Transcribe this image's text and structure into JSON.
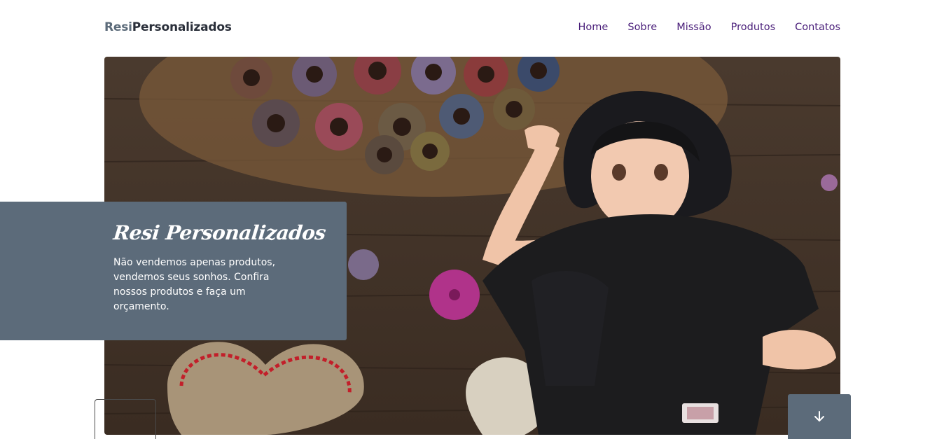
{
  "header": {
    "logo_prefix": "Resi",
    "logo_suffix": "Personalizados",
    "nav": [
      {
        "label": "Home"
      },
      {
        "label": "Sobre"
      },
      {
        "label": "Missão"
      },
      {
        "label": "Produtos"
      },
      {
        "label": "Contatos"
      }
    ]
  },
  "hero": {
    "image_semantic": "anime-girl-with-sewing-supplies",
    "caption_title": "Resi Personalizados",
    "caption_text": "Não vendemos apenas produtos, vendemos seus sonhos. Confira nossos produtos e faça um orçamento."
  },
  "controls": {
    "scroll_icon": "arrow-down-icon"
  },
  "colors": {
    "nav_link": "#4a1f7a",
    "caption_bg": "#5c6b7a",
    "logo_accent": "#5c6b7a"
  }
}
